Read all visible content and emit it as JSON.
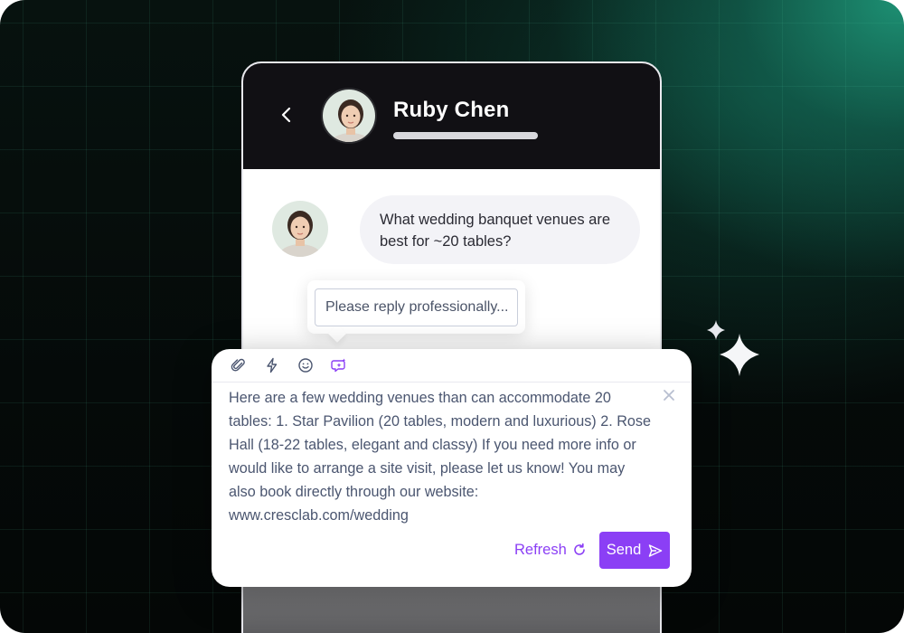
{
  "header": {
    "contact_name": "Ruby Chen"
  },
  "conversation": {
    "customer_message": "What wedding banquet venues are best for ~20 tables?"
  },
  "prompt": {
    "value": "Please reply professionally..."
  },
  "composer": {
    "toolbar_icons": [
      "paperclip-icon",
      "lightning-icon",
      "emoji-icon",
      "ai-assist-icon"
    ],
    "reply_text": "Here are a few wedding venues than can accommodate 20 tables: 1. Star Pavilion (20 tables, modern and luxurious) 2. Rose Hall (18-22 tables, elegant and classy) If you need more info or would like to arrange a site visit, please let us know! You may also book directly through our website: www.cresclab.com/wedding",
    "refresh_label": "Refresh",
    "send_label": "Send"
  },
  "colors": {
    "accent": "#8b3ff5",
    "header_bg": "#111014",
    "bubble_bg": "#f3f3f7",
    "text_body": "#4b5670"
  }
}
